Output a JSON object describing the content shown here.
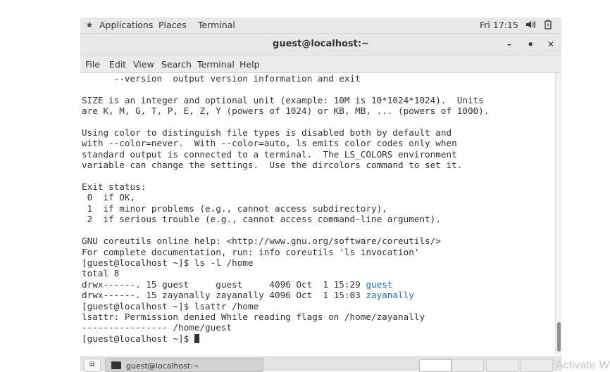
{
  "top_panel": {
    "applications": "Applications",
    "places": "Places",
    "terminal": "Terminal",
    "clock": "Fri 17:15",
    "icons": [
      "volume-icon",
      "battery-icon"
    ]
  },
  "window": {
    "title": "guest@localhost:~",
    "controls": {
      "minimize": "–",
      "maximize": "▪",
      "close": "✕"
    }
  },
  "menubar": {
    "items": [
      "File",
      "Edit",
      "View",
      "Search",
      "Terminal",
      "Help"
    ]
  },
  "terminal_lines": [
    {
      "text": "      --version  output version information and exit"
    },
    {
      "text": ""
    },
    {
      "text": "SIZE is an integer and optional unit (example: 10M is 10*1024*1024).  Units"
    },
    {
      "text": "are K, M, G, T, P, E, Z, Y (powers of 1024) or KB, MB, ... (powers of 1000)."
    },
    {
      "text": ""
    },
    {
      "text": "Using color to distinguish file types is disabled both by default and"
    },
    {
      "text": "with --color=never.  With --color=auto, ls emits color codes only when"
    },
    {
      "text": "standard output is connected to a terminal.  The LS_COLORS environment"
    },
    {
      "text": "variable can change the settings.  Use the dircolors command to set it."
    },
    {
      "text": ""
    },
    {
      "text": "Exit status:"
    },
    {
      "text": " 0  if OK,"
    },
    {
      "text": " 1  if minor problems (e.g., cannot access subdirectory),"
    },
    {
      "text": " 2  if serious trouble (e.g., cannot access command-line argument)."
    },
    {
      "text": ""
    },
    {
      "text": "GNU coreutils online help: <http://www.gnu.org/software/coreutils/>"
    },
    {
      "text": "For complete documentation, run: info coreutils 'ls invocation'"
    },
    {
      "text": "[guest@localhost ~]$ ls -l /home"
    },
    {
      "text": "total 8"
    },
    {
      "text": "drwx------. 15 guest     guest     4096 Oct  1 15:29 ",
      "dir": "guest"
    },
    {
      "text": "drwx------. 15 zayanally zayanally 4096 Oct  1 15:03 ",
      "dir": "zayanally"
    },
    {
      "text": "[guest@localhost ~]$ lsattr /home"
    },
    {
      "text": "lsattr: Permission denied While reading flags on /home/zayanally"
    },
    {
      "text": "---------------- /home/guest"
    },
    {
      "text": "[guest@localhost ~]$ ",
      "cursor": true
    }
  ],
  "taskbar": {
    "task_label": "guest@localhost:~",
    "workspaces": 4,
    "active_workspace": 1
  },
  "watermark": "Activate W"
}
